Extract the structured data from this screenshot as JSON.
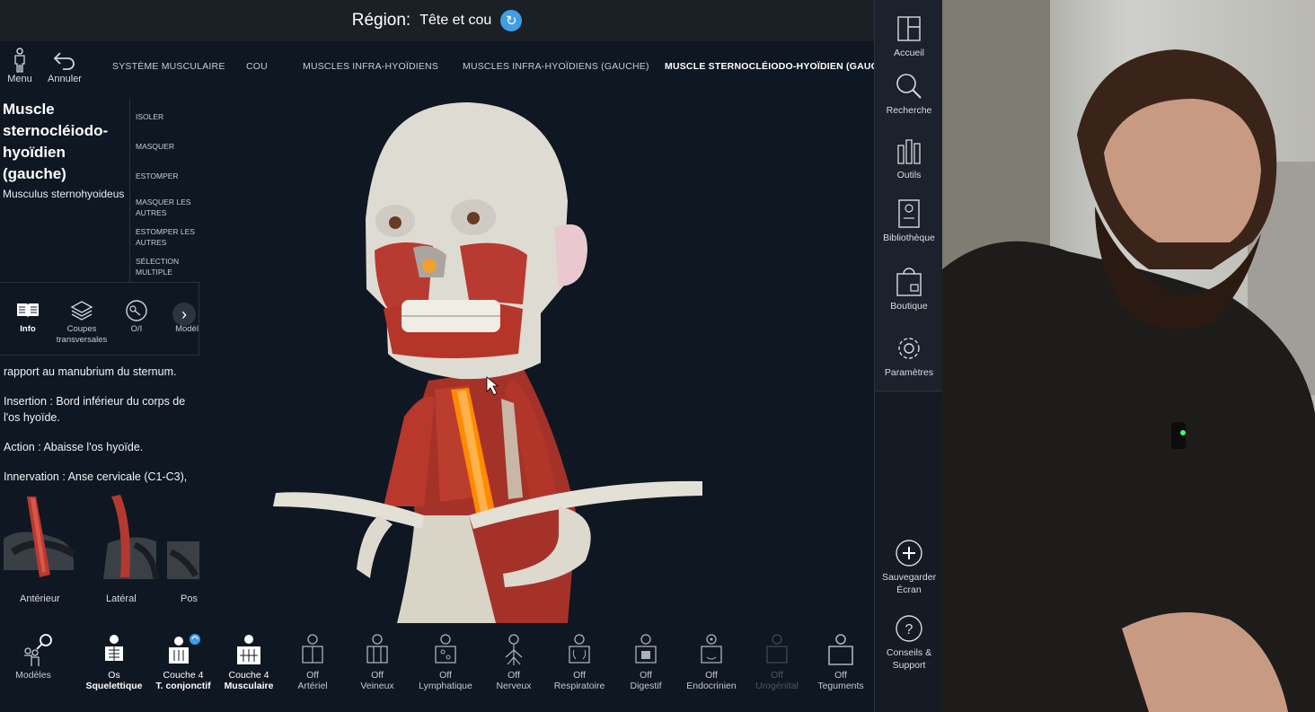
{
  "region": {
    "label": "Région:",
    "value": "Tête et cou"
  },
  "nav": {
    "menu_label": "Menu",
    "undo_label": "Annuler",
    "breadcrumbs": [
      "SYSTÈME MUSCULAIRE",
      "COU",
      "MUSCLES INFRA-HYOÏDIENS",
      "MUSCLES INFRA-HYOÏDIENS (GAUCHE)",
      "MUSCLE STERNOCLÉIODO-HYOÏDIEN (GAUCHE)"
    ]
  },
  "structure": {
    "title": "Muscle sternocléiodo-hyoïdien (gauche)",
    "latin": "Musculus sternohyoideus"
  },
  "actions": [
    "ISOLER",
    "MASQUER",
    "ESTOMPER",
    "MASQUER LES AUTRES",
    "ESTOMPER LES AUTRES",
    "SÉLECTION MULTIPLE"
  ],
  "tabs": [
    {
      "label": "Info",
      "icon": "book-icon"
    },
    {
      "label": "Coupes transversales",
      "icon": "layers-icon"
    },
    {
      "label": "O/I",
      "icon": "origin-insertion-icon"
    },
    {
      "label": "Modèl",
      "icon": "model-icon"
    }
  ],
  "info": {
    "line0": "rapport au manubrium du sternum.",
    "insertion": "Insertion : Bord inférieur du corps de l'os hyoïde.",
    "action": "Action : Abaisse l'os hyoïde.",
    "innervation": "Innervation : Anse cervicale (C1-C3),"
  },
  "thumbnails": [
    "Antérieur",
    "Latéral",
    "Pos"
  ],
  "dock": [
    {
      "l1": "",
      "l2": "Modèles",
      "icon": "models-icon",
      "state": "normal"
    },
    {
      "l1": "Os",
      "l2": "Squelettique",
      "icon": "skeleton-icon",
      "state": "on"
    },
    {
      "l1": "Couche 4",
      "l2": "T. conjonctif",
      "icon": "connective-tissue-icon",
      "state": "on"
    },
    {
      "l1": "Couche 4",
      "l2": "Musculaire",
      "icon": "muscle-icon",
      "state": "on"
    },
    {
      "l1": "Off",
      "l2": "Artériel",
      "icon": "arterial-icon",
      "state": "normal"
    },
    {
      "l1": "Off",
      "l2": "Veineux",
      "icon": "venous-icon",
      "state": "normal"
    },
    {
      "l1": "Off",
      "l2": "Lymphatique",
      "icon": "lymphatic-icon",
      "state": "normal"
    },
    {
      "l1": "Off",
      "l2": "Nerveux",
      "icon": "nervous-icon",
      "state": "normal"
    },
    {
      "l1": "Off",
      "l2": "Respiratoire",
      "icon": "respiratory-icon",
      "state": "normal"
    },
    {
      "l1": "Off",
      "l2": "Digestif",
      "icon": "digestive-icon",
      "state": "normal"
    },
    {
      "l1": "Off",
      "l2": "Endocrinien",
      "icon": "endocrine-icon",
      "state": "normal"
    },
    {
      "l1": "Off",
      "l2": "Urogénital",
      "icon": "urogenital-icon",
      "state": "dim"
    },
    {
      "l1": "Off",
      "l2": "Teguments",
      "icon": "integument-icon",
      "state": "normal"
    }
  ],
  "side": {
    "home": "Accueil",
    "search": "Recherche",
    "tools": "Outils",
    "library": "Bibliothèque",
    "shop": "Boutique",
    "settings": "Paramètres",
    "save_screen": "Sauvegarder Écran",
    "help": "Conseils & Support"
  },
  "colors": {
    "accent": "#3f9ee6",
    "background": "#0f1722",
    "highlight": "#ff8a00",
    "muscle": "#b8362b"
  }
}
